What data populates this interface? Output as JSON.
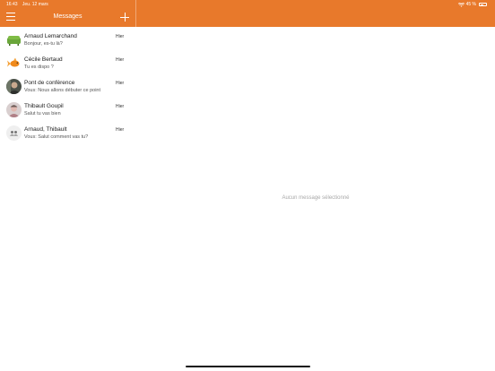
{
  "status": {
    "time": "16:43",
    "date": "Jeu. 12 mars",
    "battery_percent": "45 %",
    "battery_level": 0.45
  },
  "header": {
    "title": "Messages",
    "menu_icon": "hamburger-menu-icon",
    "add_icon": "plus-icon"
  },
  "conversations": [
    {
      "name": "Arnaud Lemarchand",
      "preview": "Bonjour, es-tu là?",
      "time": "Hier",
      "avatar_icon": "couch-photo-avatar"
    },
    {
      "name": "Cécile Bertaud",
      "preview": "Tu es dispo ?",
      "time": "Hier",
      "avatar_icon": "goldfish-photo-avatar"
    },
    {
      "name": "Pont de conférence",
      "preview": "Vous: Nous allons débuter ce point",
      "time": "Hier",
      "avatar_icon": "person-photo-avatar"
    },
    {
      "name": "Thibault Goupil",
      "preview": "Salut tu vas bien",
      "time": "Hier",
      "avatar_icon": "person-photo-avatar"
    },
    {
      "name": "Arnaud, Thibault",
      "preview": "Vous: Salut comment vas tu?",
      "time": "Hier",
      "avatar_icon": "group-icon"
    }
  ],
  "detail": {
    "empty_text": "Aucun message sélectionné"
  },
  "colors": {
    "accent": "#e8792b"
  }
}
